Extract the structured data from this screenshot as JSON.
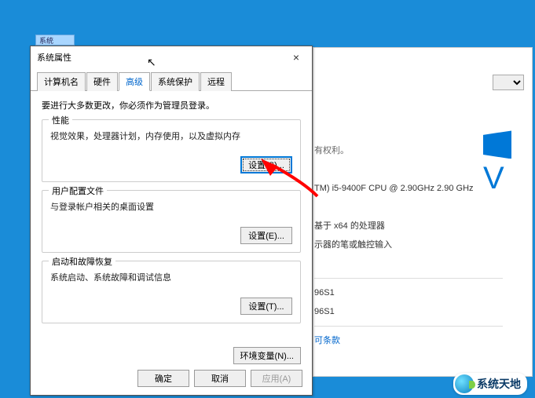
{
  "dialog": {
    "title": "系统属性",
    "tabs": [
      {
        "label": "计算机名"
      },
      {
        "label": "硬件"
      },
      {
        "label": "高级"
      },
      {
        "label": "系统保护"
      },
      {
        "label": "远程"
      }
    ],
    "intro": "要进行大多数更改，你必须作为管理员登录。",
    "groups": {
      "performance": {
        "title": "性能",
        "desc": "视觉效果，处理器计划，内存使用，以及虚拟内存",
        "button": "设置(S)..."
      },
      "user_profiles": {
        "title": "用户配置文件",
        "desc": "与登录帐户相关的桌面设置",
        "button": "设置(E)..."
      },
      "startup": {
        "title": "启动和故障恢复",
        "desc": "系统启动、系统故障和调试信息",
        "button": "设置(T)..."
      }
    },
    "env_button": "环境变量(N)...",
    "buttons": {
      "ok": "确定",
      "cancel": "取消",
      "apply": "应用(A)"
    }
  },
  "background": {
    "rights": "有权利。",
    "cpu": "TM) i5-9400F CPU @ 2.90GHz   2.90 GHz",
    "arch": "基于 x64 的处理器",
    "pen": "示器的笔或触控输入",
    "id1": "96S1",
    "id2": "96S1",
    "terms_link": "可条款"
  },
  "file_tab": "系统",
  "watermark": "系统天地"
}
